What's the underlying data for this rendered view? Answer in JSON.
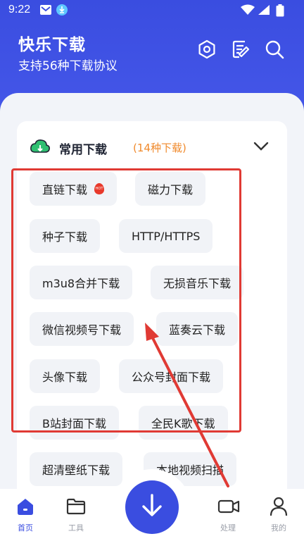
{
  "status_bar": {
    "time": "9:22"
  },
  "header": {
    "title": "快乐下载",
    "subtitle": "支持56种下载协议"
  },
  "section": {
    "title": "常用下载",
    "count": "(14种下载)"
  },
  "chips": [
    {
      "label": "直链下载",
      "hot": true
    },
    {
      "label": "磁力下载"
    },
    {
      "label": "种子下载"
    },
    {
      "label": "HTTP/HTTPS"
    },
    {
      "label": "m3u8合并下载"
    },
    {
      "label": "无损音乐下载"
    },
    {
      "label": "微信视频号下载"
    },
    {
      "label": "蓝奏云下载"
    },
    {
      "label": "头像下载"
    },
    {
      "label": "公众号封面下载"
    },
    {
      "label": "B站封面下载"
    },
    {
      "label": "全民K歌下载"
    },
    {
      "label": "超清壁纸下载"
    },
    {
      "label": "本地视频扫描"
    }
  ],
  "tabbar": {
    "home": "首页",
    "tools": "工具",
    "process": "处理",
    "mine": "我的"
  },
  "colors": {
    "primary": "#3a4de0",
    "accent_orange": "#f08a2c",
    "annotation_red": "#e03a34",
    "cloud_green": "#2fbf71"
  },
  "icons": {
    "settings": "gear-icon",
    "notes": "notes-icon",
    "search": "search-icon",
    "expand": "chevron-down-icon",
    "download": "download-icon"
  }
}
